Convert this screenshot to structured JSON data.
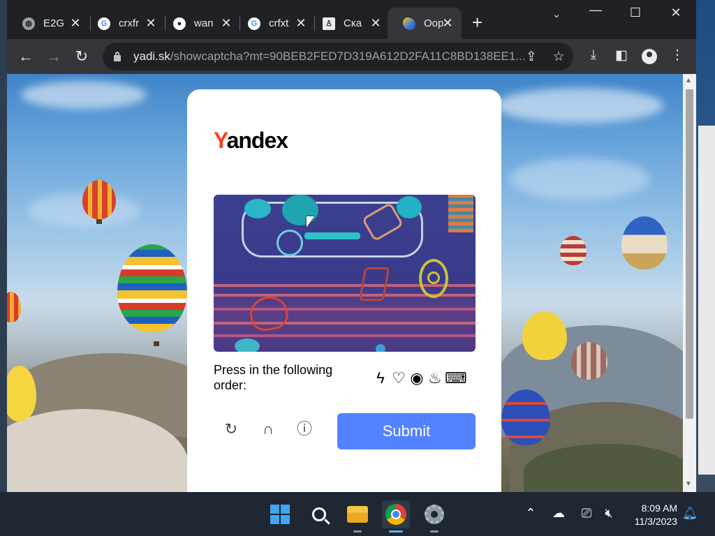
{
  "tabs": [
    {
      "title": "E2G",
      "favicon": "globe-icon"
    },
    {
      "title": "crxfr",
      "favicon": "google-icon"
    },
    {
      "title": "wan",
      "favicon": "github-icon"
    },
    {
      "title": "crfxt",
      "favicon": "google-icon"
    },
    {
      "title": "Ска",
      "favicon": "counter-strike-icon"
    },
    {
      "title": "Oop",
      "favicon": "yandex-disk-icon",
      "active": true
    }
  ],
  "toolbar": {
    "url_domain": "yadi.sk",
    "url_path": "/showcaptcha?mt=90BEB2FED7D319A612D2FA11C8BD138EE1..."
  },
  "captcha": {
    "logo_first": "Y",
    "logo_rest": "andex",
    "instruction": "Press in the following order:",
    "target_icons": [
      "lightning-icon",
      "heart-icon",
      "eye-icon",
      "flame-icon",
      "keyboard-icon"
    ],
    "submit_label": "Submit",
    "accent_color": "#5282ff",
    "logo_color": "#fc3f1d"
  },
  "taskbar": {
    "time": "8:09 AM",
    "date": "11/3/2023",
    "apps": [
      "windows-start-icon",
      "search-icon",
      "file-explorer-icon",
      "chrome-icon",
      "settings-icon"
    ],
    "active_app": "chrome-icon"
  }
}
